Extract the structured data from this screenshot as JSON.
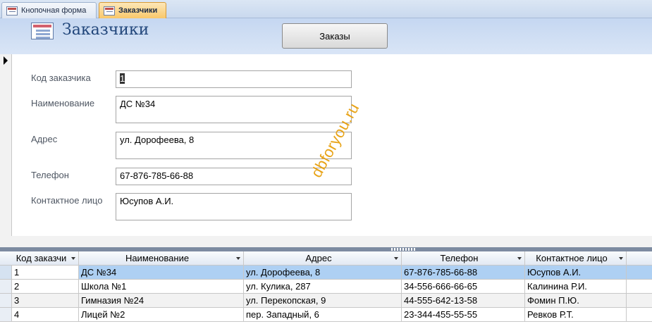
{
  "tabs": [
    {
      "label": "Кнопочная форма",
      "active": false
    },
    {
      "label": "Заказчики",
      "active": true
    }
  ],
  "header": {
    "title": "Заказчики",
    "orders_button": "Заказы",
    "background": "#c5d7f1"
  },
  "form": {
    "fields": [
      {
        "label": "Код заказчика",
        "value": "1"
      },
      {
        "label": "Наименование",
        "value": "ДС №34"
      },
      {
        "label": "Адрес",
        "value": "ул. Дорофеева, 8"
      },
      {
        "label": "Телефон",
        "value": "67-876-785-66-88"
      },
      {
        "label": "Контактное лицо",
        "value": "Юсупов А.И."
      }
    ],
    "watermark": "dbforyou.ru"
  },
  "datasheet": {
    "columns": [
      "Код заказчи",
      "Наименование",
      "Адрес",
      "Телефон",
      "Контактное лицо"
    ],
    "rows": [
      [
        "1",
        "ДС №34",
        "ул. Дорофеева, 8",
        "67-876-785-66-88",
        "Юсупов А.И."
      ],
      [
        "2",
        "Школа №1",
        "ул. Кулика, 287",
        "34-556-666-66-65",
        "Калинина Р.И."
      ],
      [
        "3",
        "Гимназия №24",
        "ул. Перекопская, 9",
        "44-555-642-13-58",
        "Фомин П.Ю."
      ],
      [
        "4",
        "Лицей №2",
        "пер. Западный, 6",
        "23-344-455-55-55",
        "Ревков Р.Т."
      ]
    ],
    "selected_row": 0,
    "selection_color": "#aed0f3"
  }
}
